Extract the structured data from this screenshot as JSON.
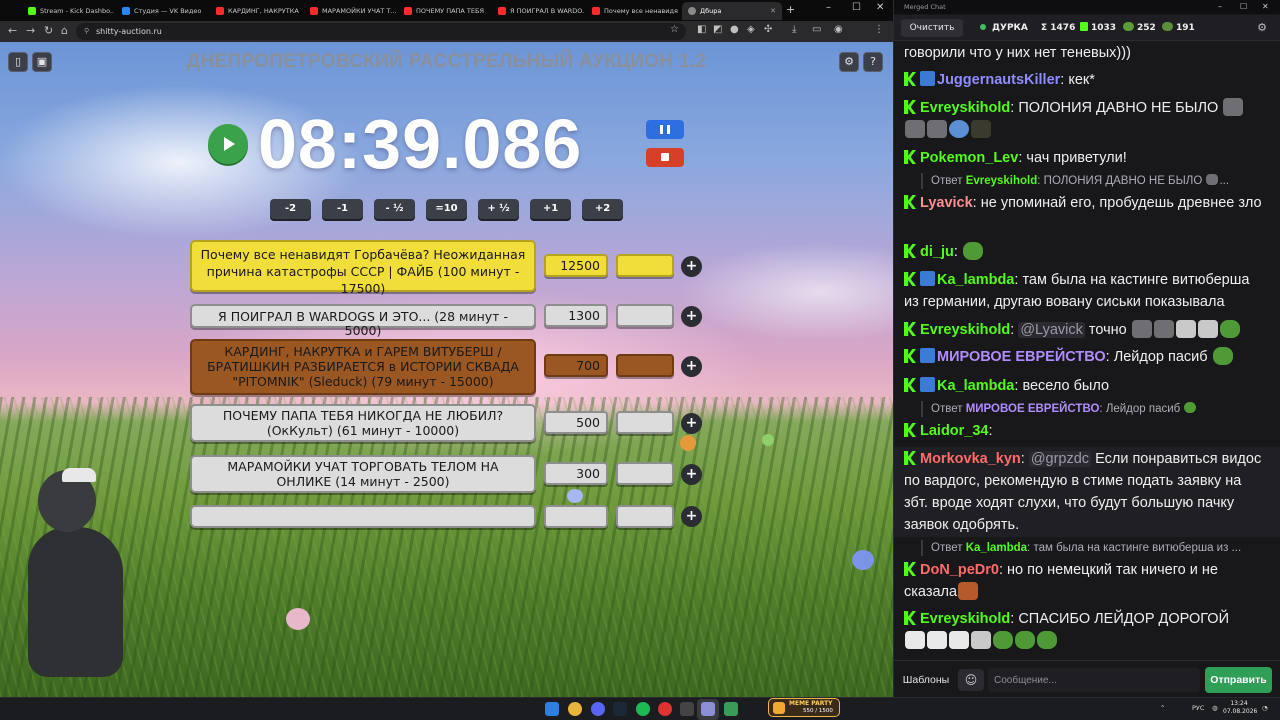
{
  "browser": {
    "tabs": [
      {
        "label": "Stream - Kick Dashbo...",
        "fav": "k"
      },
      {
        "label": "Студия — VK Видео",
        "fav": "vk"
      },
      {
        "label": "КАРДИНГ, НАКРУТКА",
        "fav": "yt"
      },
      {
        "label": "МАРАМОЙКИ УЧАТ Т...",
        "fav": "yt"
      },
      {
        "label": "ПОЧЕМУ ПАПА ТЕБЯ",
        "fav": "yt"
      },
      {
        "label": "Я ПОИГРАЛ В WARDO...",
        "fav": "yt"
      },
      {
        "label": "Почему все ненавидя...",
        "fav": "yt"
      },
      {
        "label": "Дбuра",
        "fav": "da"
      }
    ],
    "url": "shitty-auction.ru"
  },
  "auction": {
    "title": "ДНЕПРОПЕТРОВСКИЙ РАССТРЕЛЬНЫЙ АУКЦИОН 1.2",
    "timer": "08:39.086",
    "adjust_buttons": [
      "-2",
      "-1",
      "- ½",
      "=10",
      "+ ½",
      "+1",
      "+2"
    ],
    "lots": [
      {
        "name": "Почему все ненавидят Горбачёва? Неожиданная причина катастрофы СССР | ФАЙБ (100 минут - 17500)",
        "amount": "12500",
        "color": "#f1de3a"
      },
      {
        "name": "Я ПОИГРАЛ В WARDOGS И ЭТО... (28 минут - 5000)",
        "amount": "1300",
        "color": "#dcdcdc"
      },
      {
        "name": "КАРДИНГ, НАКРУТКА и ГАРЕМ ВИТУБЕРШ / БРАТИШКИН РАЗБИРАЕТСЯ в ИСТОРИИ СКВАДА \"PITOMNIK\" (Sleduck) (79 минут - 15000)",
        "amount": "700",
        "color": "#9b5722"
      },
      {
        "name": "ПОЧЕМУ ПАПА ТЕБЯ НИКОГДА НЕ ЛЮБИЛ? (ОкКульт) (61 минут - 10000)",
        "amount": "500",
        "color": "#dcdcdc"
      },
      {
        "name": "МАРАМОЙКИ УЧАТ ТОРГОВАТЬ ТЕЛОМ НА ОНЛИКЕ (14 минут - 2500)",
        "amount": "300",
        "color": "#dcdcdc"
      },
      {
        "name": "",
        "amount": "",
        "color": "#dcdcdc"
      }
    ],
    "add_symbol": "+"
  },
  "chat": {
    "window_title": "Merged Chat",
    "clear_label": "Очистить",
    "channel": "ДУРКА",
    "stat_total": "Σ 1476",
    "stat_kick": "1033",
    "stat_pepe": "252",
    "stat_other": "191",
    "reply_prefix": "Ответ",
    "messages": [
      {
        "user": "",
        "color": "#efeff1",
        "text": "говорили что у них нет теневых)))"
      },
      {
        "user": "JuggernautsKiller",
        "color": "#8f8cff",
        "text": "кек*"
      },
      {
        "user": "Evreyskihold",
        "color": "#53fc18",
        "text": "ПОЛОНИЯ ДАВНО НЕ БЫЛО"
      },
      {
        "user": "Pokemon_Lev",
        "color": "#53fc18",
        "text": "чач приветули!"
      },
      {
        "reply_user": "Evreyskihold",
        "reply_text": "ПОЛОНИЯ ДАВНО НЕ БЫЛО"
      },
      {
        "user": "Lyavick",
        "color": "#ff8f8f",
        "text": "не упоминай его, пробудешь древнее зло"
      },
      {
        "user": "di_ju",
        "color": "#53fc18",
        "text": ""
      },
      {
        "user": "Ka_lambda",
        "color": "#53fc18",
        "text": "там была на кастинге витюберша из германии, другаю вовану сиськи показывала"
      },
      {
        "user": "Evreyskihold",
        "color": "#53fc18",
        "mention": "@Lyavick",
        "text": "точно"
      },
      {
        "user": "МИРОВОЕ ЕВРЕЙСТВО",
        "color": "#b18cff",
        "text": "Лейдор пасиб"
      },
      {
        "user": "Ka_lambda",
        "color": "#53fc18",
        "text": "весело было"
      },
      {
        "reply_user": "МИРОВОЕ ЕВРЕЙСТВО",
        "reply_text": "Лейдор пасиб"
      },
      {
        "user": "Laidor_34",
        "color": "#53fc18",
        "text": ""
      },
      {
        "user": "Morkovka_kyn",
        "color": "#ff6b6b",
        "mention": "@grpzdc",
        "text": "Если понравиться видос по вардогс, рекомендую в стиме подать заявку на збт. вроде ходят слухи, что будут большую пачку заявок одобрять."
      },
      {
        "reply_user": "Ka_lambda",
        "reply_text": "там была на кастинге витюберша из ..."
      },
      {
        "user": "DoN_peDr0",
        "color": "#ff6b6b",
        "text": "но по немецкий так ничего и не сказала"
      },
      {
        "user": "Evreyskihold",
        "color": "#53fc18",
        "text": "СПАСИБО ЛЕЙДОР ДОРОГОЙ"
      }
    ],
    "templates_label": "Шаблоны",
    "input_placeholder": "Сообщение...",
    "send_label": "Отправить"
  },
  "taskbar": {
    "badge_title": "MEME PARTY",
    "badge_value": "550 / 1500",
    "lang": "РУС",
    "time": "13:24",
    "date": "07.08.2026"
  }
}
